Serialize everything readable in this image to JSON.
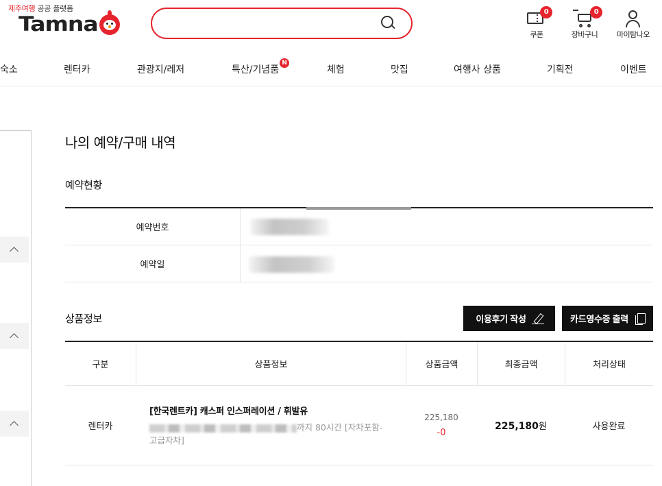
{
  "header": {
    "tagline_red": "제주여행",
    "tagline_rest": " 공공 플랫폼",
    "logo_text": "Tamna",
    "search_placeholder": "",
    "coupon": {
      "label": "쿠폰",
      "count": "0"
    },
    "cart": {
      "label": "장바구니",
      "count": "0"
    },
    "mypage": {
      "label": "마이탐나오"
    }
  },
  "nav": [
    {
      "label": "숙소"
    },
    {
      "label": "렌터카"
    },
    {
      "label": "관광지/레저"
    },
    {
      "label": "특산/기념품",
      "badge": "N"
    },
    {
      "label": "체험"
    },
    {
      "label": "맛집"
    },
    {
      "label": "여행사 상품"
    },
    {
      "label": "기획전"
    },
    {
      "label": "이벤트"
    }
  ],
  "main": {
    "page_title": "나의 예약/구매 내역",
    "reservation_section": "예약현황",
    "reservation_rows": [
      {
        "label": "예약번호"
      },
      {
        "label": "예약일"
      }
    ],
    "product_section": "상품정보",
    "review_button": "이용후기 작성",
    "receipt_button": "카드영수증 출력",
    "table_headers": [
      "구분",
      "상품정보",
      "상품금액",
      "최종금액",
      "처리상태"
    ],
    "rows": [
      {
        "category": "렌터카",
        "product_name": "[한국렌트카] 캐스퍼 인스퍼레이션 / 휘발유",
        "product_desc_suffix": "까지 80시간 [자차포함-고급자차]",
        "price_original": "225,180",
        "price_discount": "-0",
        "price_final": "225,180",
        "price_unit": "원",
        "status": "사용완료"
      }
    ]
  }
}
